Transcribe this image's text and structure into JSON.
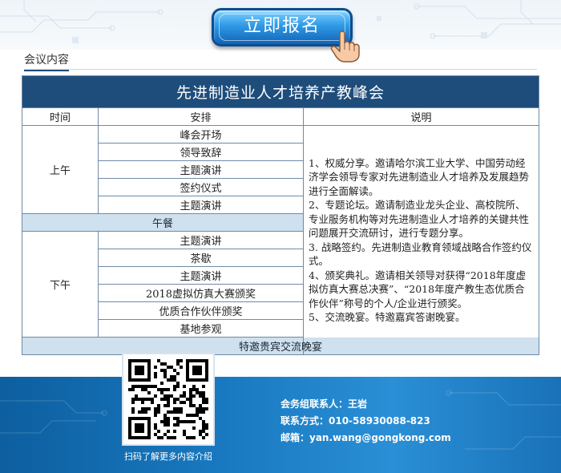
{
  "header": {
    "register_label": "立即报名",
    "section_label": "会议内容"
  },
  "agenda": {
    "title": "先进制造业人才培养产教峰会",
    "columns": [
      "时间",
      "安排",
      "说明"
    ],
    "morning": {
      "period": "上午",
      "items": [
        "峰会开场",
        "领导致辞",
        "主题演讲",
        "签约仪式",
        "主题演讲"
      ]
    },
    "lunch": "午餐",
    "afternoon": {
      "period": "下午",
      "items": [
        "主题演讲",
        "茶歇",
        "主题演讲",
        "2018虚拟仿真大赛颁奖",
        "优质合作伙伴颁奖",
        "基地参观"
      ]
    },
    "evening": "特邀贵宾交流晚宴",
    "notes": [
      "1、权威分享。邀请哈尔滨工业大学、中国劳动经济学会领导专家对先进制造业人才培养及发展趋势进行全面解读。",
      "2、专题论坛。邀请制造业龙头企业、高校院所、专业服务机构等对先进制造业人才培养的关键共性问题展开交流研讨，进行专题分享。",
      "3. 战略签约。先进制造业教育领域战略合作签约仪式。",
      "4、颁奖典礼。邀请相关领导对获得“2018年度虚拟仿真大赛总决赛”、“2018年度产教生态优质合作伙伴”称号的个人/企业进行颁奖。",
      "5、交流晚宴。特邀嘉宾答谢晚宴。"
    ]
  },
  "footer": {
    "qr_caption": "扫码了解更多内容介绍",
    "contact_person": "会务组联系人：王岩",
    "contact_phone": "联系方式：010-58930088-823",
    "contact_email": "邮箱：yan.wang@gongkong.com"
  },
  "colors": {
    "title_bar": "#1e4d7b",
    "band": "#cfe0ee",
    "footer_blue": "#1979c0",
    "button_blue": "#2f9ae6"
  },
  "icons": [
    "hand-pointer-icon",
    "qr-code"
  ]
}
